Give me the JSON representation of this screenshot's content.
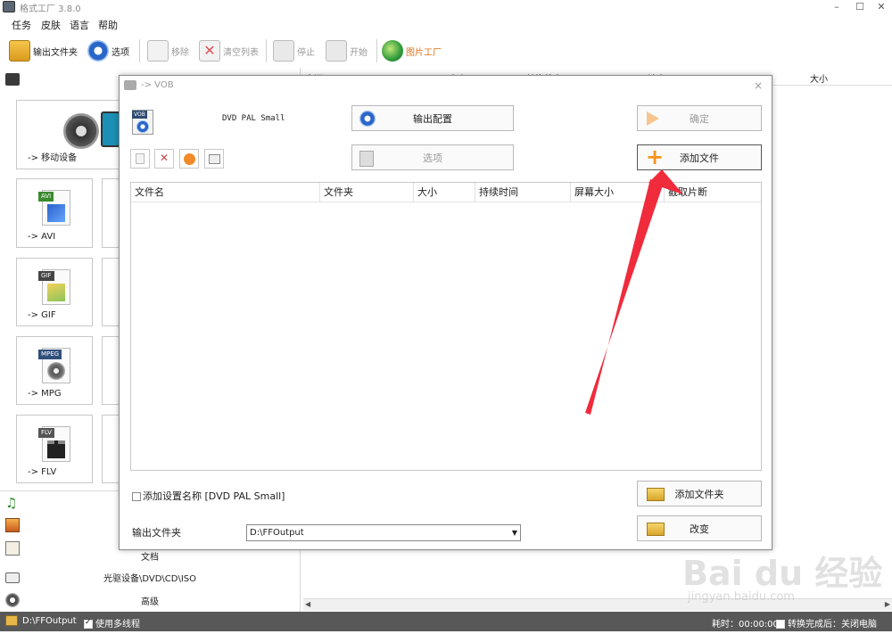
{
  "app": {
    "title": "格式工厂 3.8.0"
  },
  "window_controls": {
    "minimize": "–",
    "maximize": "☐",
    "close": "✕"
  },
  "menu": [
    "任务",
    "皮肤",
    "语言",
    "帮助"
  ],
  "toolbar": {
    "output_folder": "输出文件夹",
    "options": "选项",
    "remove": "移除",
    "clear_list": "清空列表",
    "stop": "停止",
    "start": "开始",
    "picture_factory": "图片工厂"
  },
  "left_panel": {
    "tiles": [
      {
        "label": "-> 移动设备"
      },
      {
        "label": "-> AVI",
        "tag": "AVI"
      },
      {
        "label": "-> GIF",
        "tag": "GIF"
      },
      {
        "label": "-> MPG",
        "tag": "MPEG"
      },
      {
        "label": "-> FLV",
        "tag": "FLV"
      }
    ],
    "categories": [
      "",
      "",
      "文档",
      "光驱设备\\DVD\\CD\\ISO",
      "高级"
    ]
  },
  "right_header": {
    "columns": [
      "来源",
      "大小",
      "转换状态",
      "输出 [F2]",
      "大小"
    ]
  },
  "statusbar": {
    "output_path": "D:\\FFOutput",
    "multithread": "使用多线程",
    "elapsed": "耗时：00:00:00",
    "after_convert": "转换完成后：关闭电脑"
  },
  "dialog": {
    "title": "-> VOB",
    "close": "×",
    "format_tag": "VOB",
    "format_name": "DVD PAL Small",
    "output_config": "输出配置",
    "options": "选项",
    "confirm": "确定",
    "add_file": "添加文件",
    "add_folder": "添加文件夹",
    "change": "改变",
    "table_columns": [
      "文件名",
      "文件夹",
      "大小",
      "持续时间",
      "屏幕大小",
      "截取片断"
    ],
    "add_setting_name": "添加设置名称 [DVD PAL Small]",
    "output_folder_label": "输出文件夹",
    "output_folder_value": "D:\\FFOutput"
  },
  "watermark": {
    "text": "Bai du 经验",
    "sub": "jingyan.baidu.com"
  },
  "colors": {
    "accent_arrow": "#f02b3c",
    "statusbar": "#585858",
    "plus_orange": "#f7941d"
  }
}
